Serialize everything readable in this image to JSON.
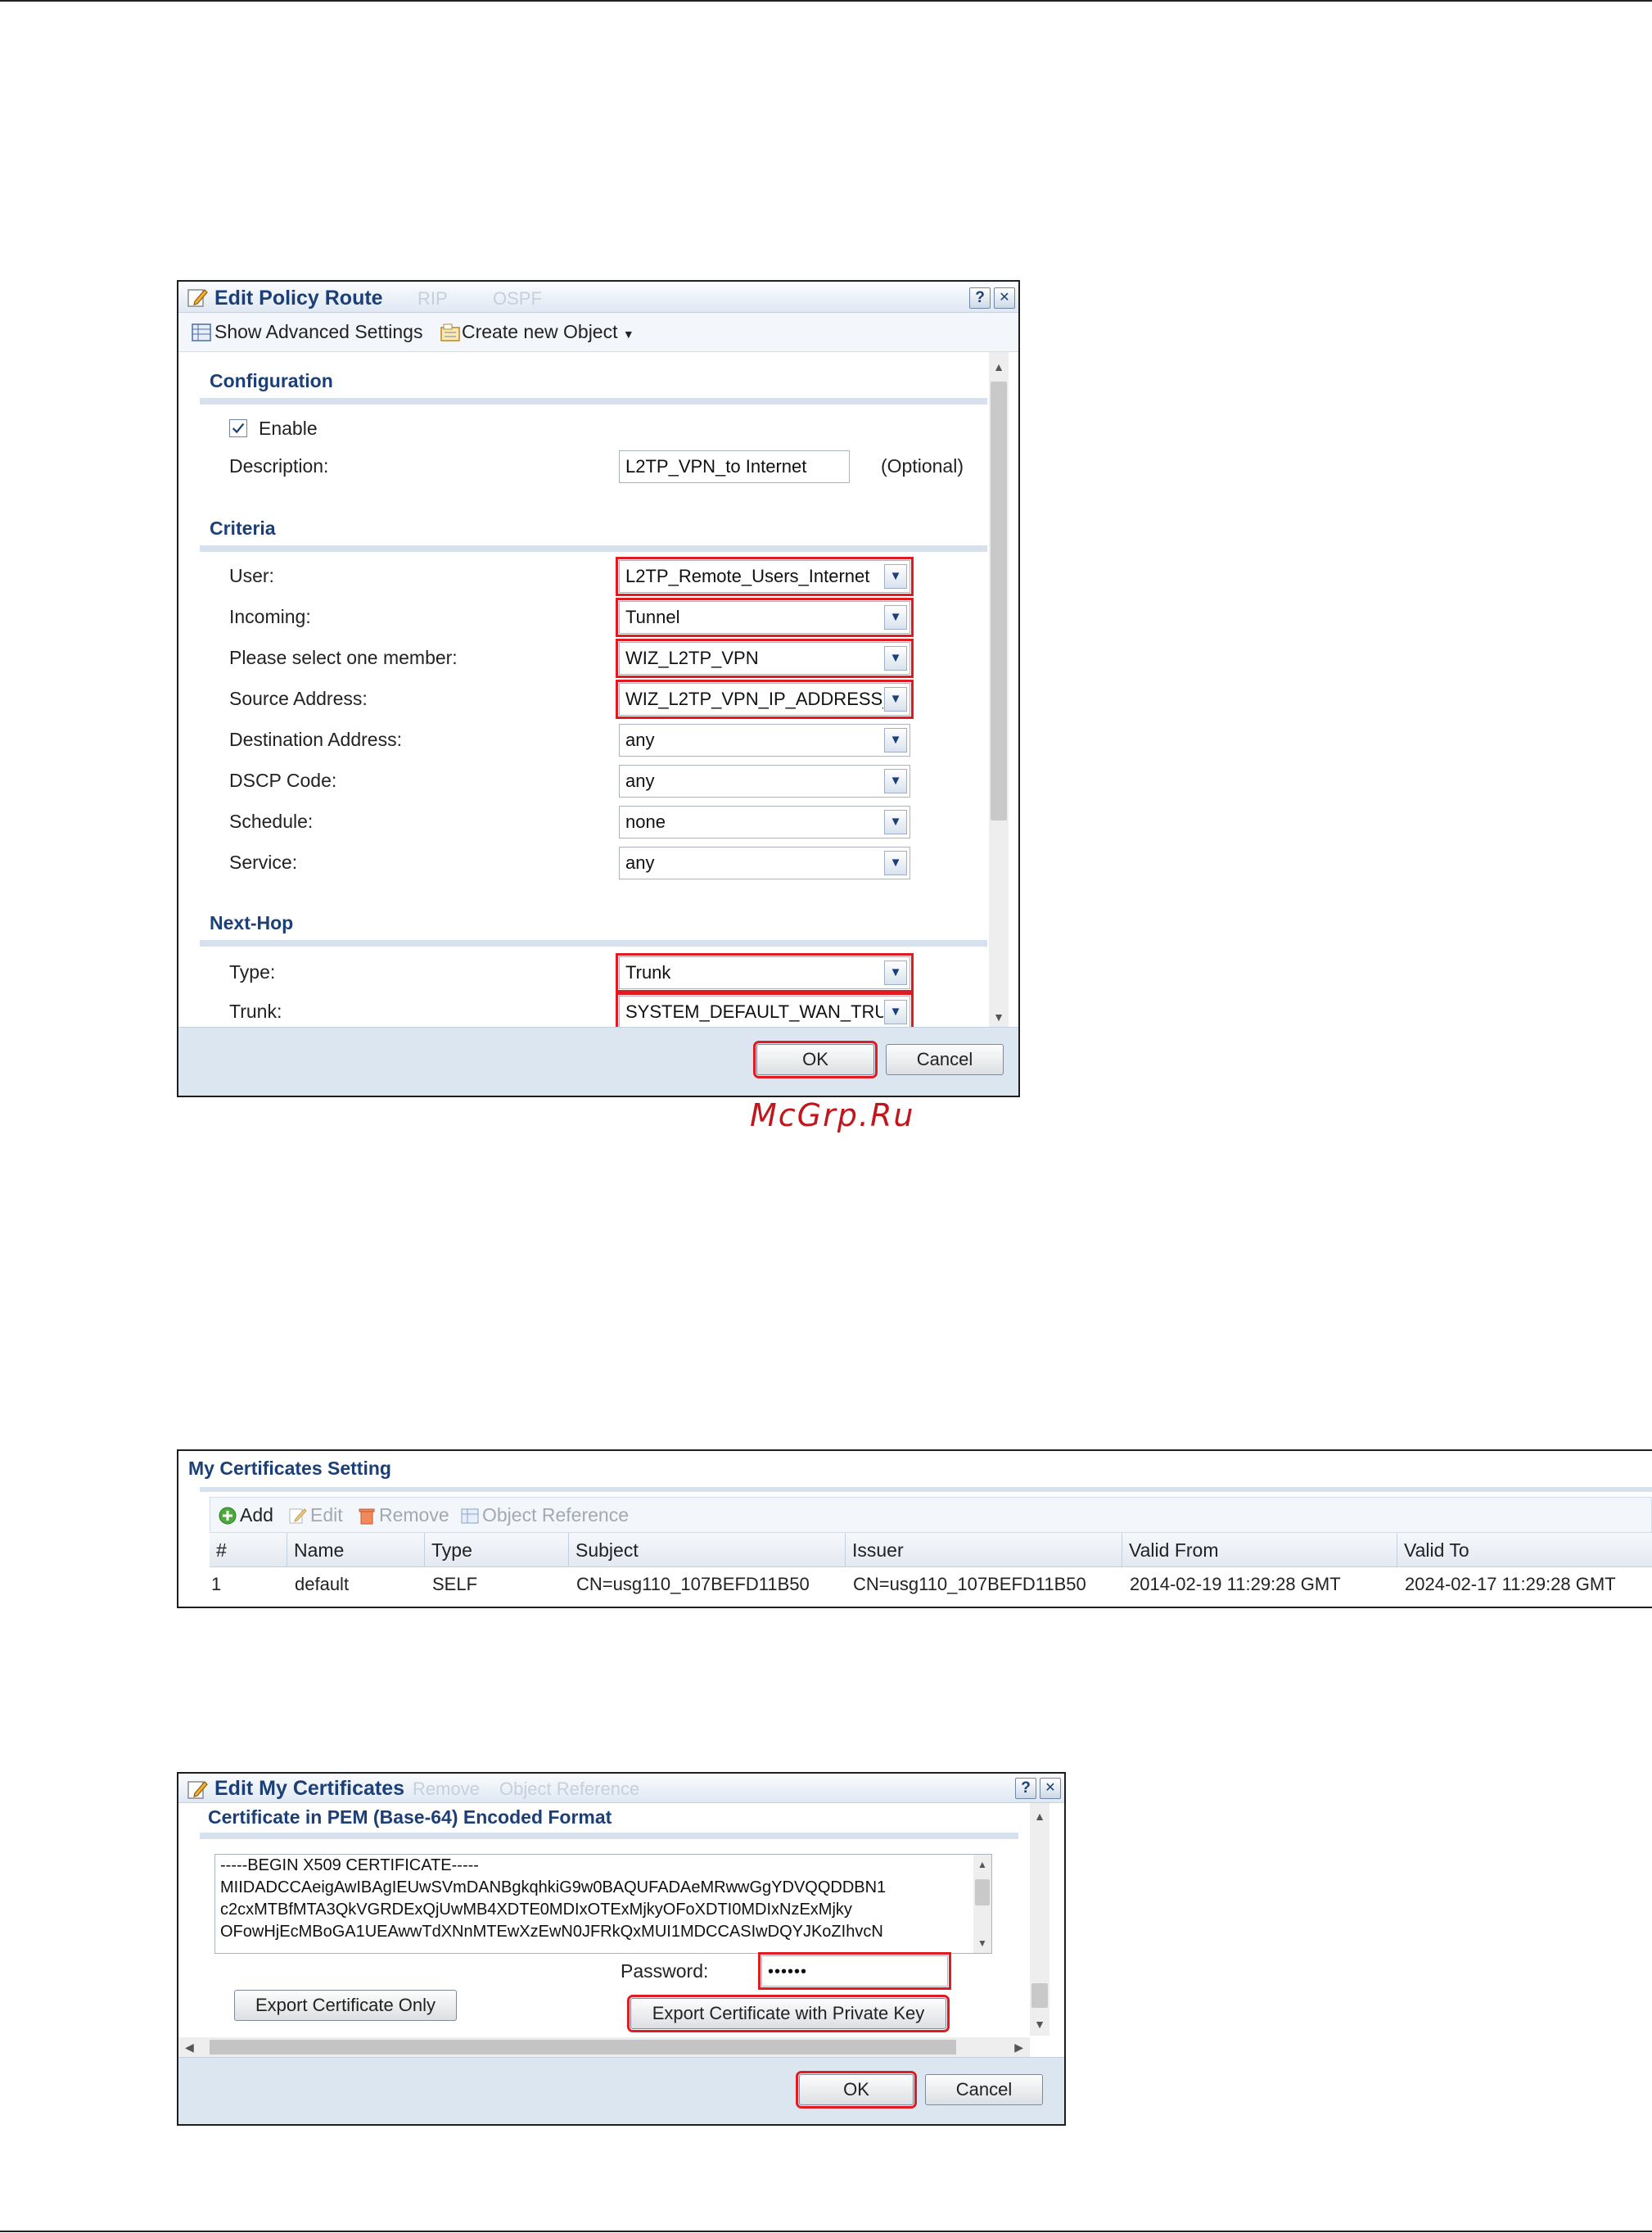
{
  "policy_route": {
    "title": "Edit Policy Route",
    "ghost_tabs": [
      "RIP",
      "OSPF"
    ],
    "help_icon": "?",
    "close_icon": "✕",
    "toolbar": {
      "show_advanced": "Show Advanced Settings",
      "create_object": "Create new Object"
    },
    "configuration": {
      "heading": "Configuration",
      "enable_label": "Enable",
      "enable_checked": true,
      "description_label": "Description:",
      "description_value": "L2TP_VPN_to Internet",
      "optional": "(Optional)"
    },
    "criteria": {
      "heading": "Criteria",
      "fields": [
        {
          "label": "User:",
          "value": "L2TP_Remote_Users_Internet",
          "highlight": true
        },
        {
          "label": "Incoming:",
          "value": "Tunnel",
          "highlight": true
        },
        {
          "label": "Please select one member:",
          "value": "WIZ_L2TP_VPN",
          "highlight": true
        },
        {
          "label": "Source Address:",
          "value": "WIZ_L2TP_VPN_IP_ADDRESS_",
          "highlight": true
        },
        {
          "label": "Destination Address:",
          "value": "any",
          "highlight": false
        },
        {
          "label": "DSCP Code:",
          "value": "any",
          "highlight": false
        },
        {
          "label": "Schedule:",
          "value": "none",
          "highlight": false
        },
        {
          "label": "Service:",
          "value": "any",
          "highlight": false
        }
      ]
    },
    "next_hop": {
      "heading": "Next-Hop",
      "fields": [
        {
          "label": "Type:",
          "value": "Trunk",
          "highlight": true
        },
        {
          "label": "Trunk:",
          "value": "SYSTEM_DEFAULT_WAN_TRU",
          "highlight": true
        }
      ]
    },
    "ok": "OK",
    "cancel": "Cancel"
  },
  "watermark": "McGrp.Ru",
  "certificates": {
    "title": "My Certificates Setting",
    "toolbar": {
      "add": "Add",
      "edit": "Edit",
      "remove": "Remove",
      "object_reference": "Object Reference"
    },
    "columns": [
      "#",
      "Name",
      "Type",
      "Subject",
      "Issuer",
      "Valid From",
      "Valid To"
    ],
    "rows": [
      [
        "1",
        "default",
        "SELF",
        "CN=usg110_107BEFD11B50",
        "CN=usg110_107BEFD11B50",
        "2014-02-19 11:29:28 GMT",
        "2024-02-17 11:29:28 GMT"
      ]
    ]
  },
  "edit_certificate": {
    "title": "Edit My Certificates",
    "ghost_items": [
      "Remove",
      "Object Reference"
    ],
    "help_icon": "?",
    "close_icon": "✕",
    "section": "Certificate in PEM (Base-64) Encoded Format",
    "pem_lines": [
      "-----BEGIN X509 CERTIFICATE-----",
      "MIIDADCCAeigAwIBAgIEUwSVmDANBgkqhkiG9w0BAQUFADAeMRwwGgYDVQQDDBN1",
      "c2cxMTBfMTA3QkVGRDExQjUwMB4XDTE0MDIxOTExMjkyOFoXDTI0MDIxNzExMjky",
      "OFowHjEcMBoGA1UEAwwTdXNnMTEwXzEwN0JFRkQxMUI1MDCCASIwDQYJKoZIhvcN"
    ],
    "password_label": "Password:",
    "password_value": "••••••",
    "export_only": "Export Certificate Only",
    "export_with_key": "Export Certificate with Private Key",
    "ok": "OK",
    "cancel": "Cancel"
  }
}
